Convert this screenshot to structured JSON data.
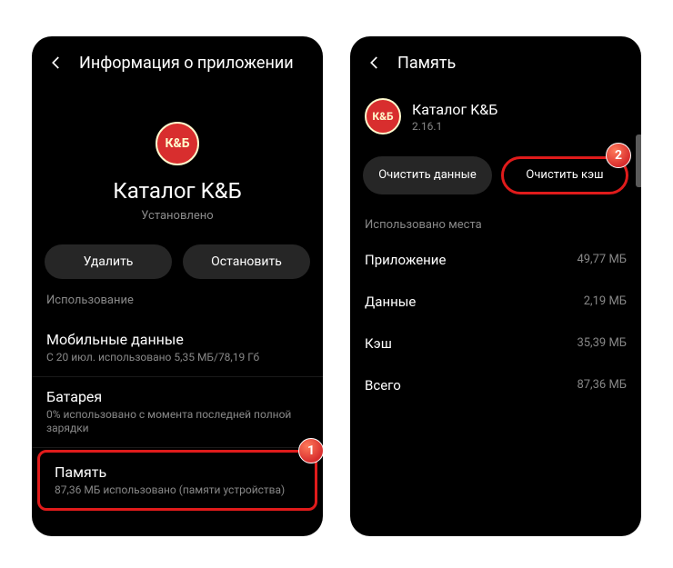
{
  "left": {
    "header": "Информация о приложении",
    "app_name": "Каталог K&Б",
    "icon_text": "К&Б",
    "status": "Установлено",
    "buttons": {
      "delete": "Удалить",
      "stop": "Остановить"
    },
    "usage_label": "Использование",
    "items": {
      "mobile": {
        "title": "Мобильные данные",
        "sub": "С 20 июл. использовано 5,35 МБ/78,19 Гб"
      },
      "battery": {
        "title": "Батарея",
        "sub": "0% использовано с момента последней полной зарядки"
      },
      "memory": {
        "title": "Память",
        "sub": "87,36 МБ использовано (памяти устройства)"
      }
    },
    "badge": "1"
  },
  "right": {
    "header": "Память",
    "app_name": "Каталог K&Б",
    "icon_text": "К&Б",
    "version": "2.16.1",
    "buttons": {
      "clear_data": "Очистить данные",
      "clear_cache": "Очистить кэш"
    },
    "storage_label": "Использовано места",
    "stats": {
      "app": {
        "label": "Приложение",
        "value": "49,77 МБ"
      },
      "data": {
        "label": "Данные",
        "value": "2,19 МБ"
      },
      "cache": {
        "label": "Кэш",
        "value": "35,39 МБ"
      },
      "total": {
        "label": "Всего",
        "value": "87,36 МБ"
      }
    },
    "badge": "2"
  }
}
